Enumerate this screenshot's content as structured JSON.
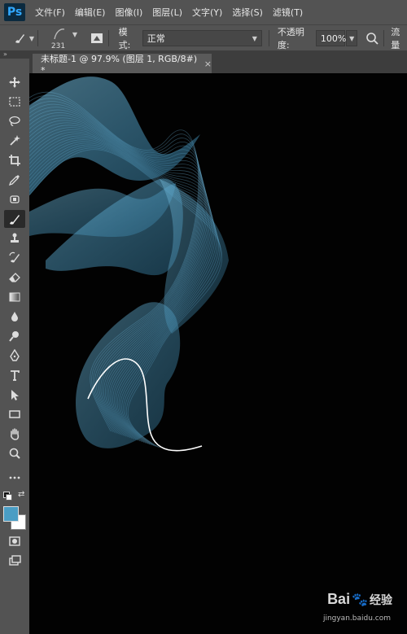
{
  "app": {
    "logo": "Ps"
  },
  "menu": [
    "文件(F)",
    "编辑(E)",
    "图像(I)",
    "图层(L)",
    "文字(Y)",
    "选择(S)",
    "滤镜(T)"
  ],
  "options": {
    "brush_size": "231",
    "mode_label": "模式:",
    "mode_value": "正常",
    "opacity_label": "不透明度:",
    "opacity_value": "100%",
    "flow_label": "流量"
  },
  "document": {
    "tab_title": "未标题-1 @ 97.9% (图层 1, RGB/8#) *",
    "close": "×"
  },
  "colors": {
    "foreground": "#4a9dc4",
    "background": "#ffffff",
    "accent": "#31a8ff"
  },
  "watermark": {
    "logo_text": "Bai",
    "logo_suffix": "经验",
    "url": "jingyan.baidu.com"
  }
}
